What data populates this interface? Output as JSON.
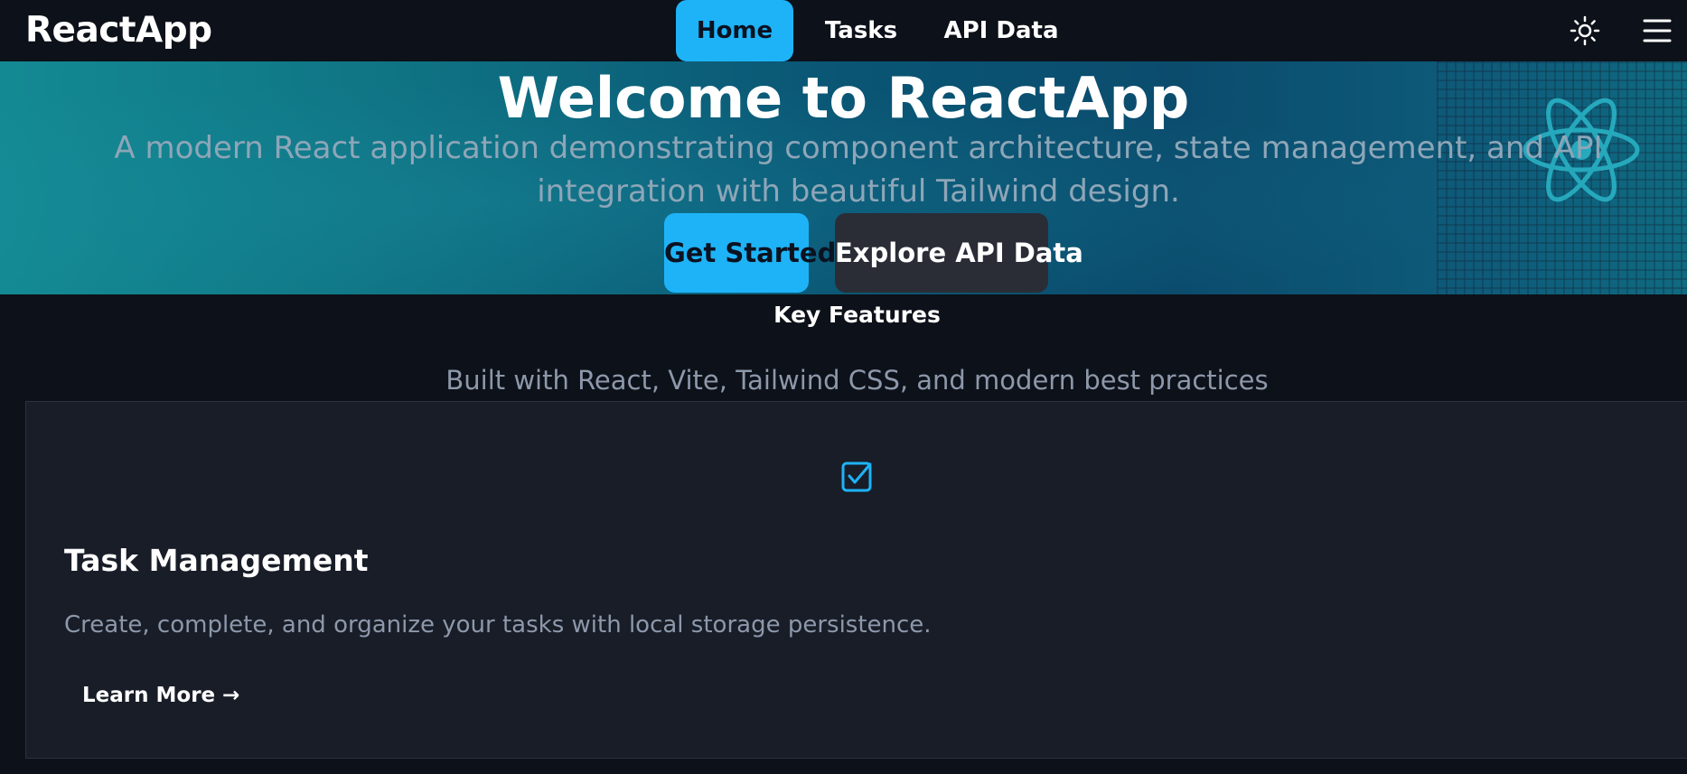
{
  "nav": {
    "brand": "ReactApp",
    "links": [
      "Home",
      "Tasks",
      "API Data"
    ],
    "active": "Home",
    "theme_icon": "sun-icon",
    "menu_icon": "hamburger-menu-icon"
  },
  "hero": {
    "title": "Welcome to ReactApp",
    "subtitle": "A modern React application demonstrating component architecture, state management, and API integration with beautiful Tailwind design.",
    "primary_button": "Get Started",
    "secondary_button": "Explore API Data",
    "decor_icon": "react-atom-icon"
  },
  "features": {
    "title": "Key Features",
    "subtitle": "Built with React, Vite, Tailwind CSS, and modern best practices",
    "cards": [
      {
        "icon": "checkbox-icon",
        "title": "Task Management",
        "description": "Create, complete, and organize your tasks with local storage persistence.",
        "link": "Learn More →"
      }
    ]
  },
  "colors": {
    "accent": "#1eb3f7",
    "background": "#0d1119",
    "card": "#181d28",
    "muted_text": "#8d98aa"
  }
}
